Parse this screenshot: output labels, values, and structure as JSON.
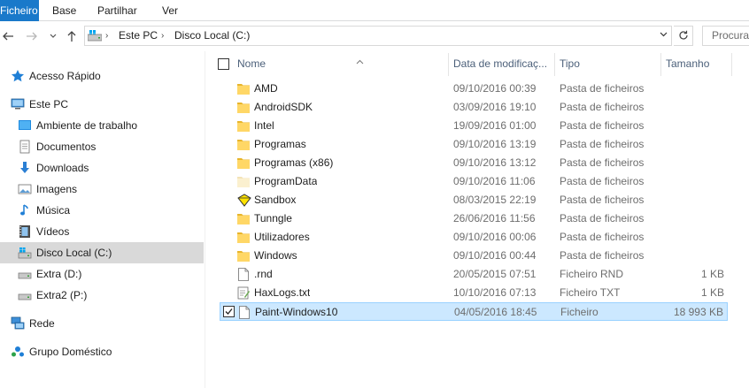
{
  "ribbon": {
    "tabs": [
      "Ficheiro",
      "Base",
      "Partilhar",
      "Ver"
    ]
  },
  "address": {
    "crumbs": [
      "Este PC",
      "Disco Local (C:)"
    ],
    "search_placeholder": "Procurar"
  },
  "sidebar": {
    "items": [
      {
        "label": "Acesso Rápido",
        "icon": "star-icon"
      },
      {
        "label": "Este PC",
        "icon": "computer-icon"
      },
      {
        "label": "Ambiente de trabalho",
        "icon": "desktop-icon"
      },
      {
        "label": "Documentos",
        "icon": "documents-icon"
      },
      {
        "label": "Downloads",
        "icon": "download-icon"
      },
      {
        "label": "Imagens",
        "icon": "pictures-icon"
      },
      {
        "label": "Música",
        "icon": "music-icon"
      },
      {
        "label": "Vídeos",
        "icon": "videos-icon"
      },
      {
        "label": "Disco Local (C:)",
        "icon": "drive-c-icon"
      },
      {
        "label": "Extra (D:)",
        "icon": "drive-icon"
      },
      {
        "label": "Extra2 (P:)",
        "icon": "drive-icon"
      },
      {
        "label": "Rede",
        "icon": "network-icon"
      },
      {
        "label": "Grupo Doméstico",
        "icon": "homegroup-icon"
      }
    ]
  },
  "columns": {
    "name": "Nome",
    "date": "Data de modificaç...",
    "type": "Tipo",
    "size": "Tamanho"
  },
  "files": [
    {
      "name": "AMD",
      "date": "09/10/2016 00:39",
      "type": "Pasta de ficheiros",
      "size": "",
      "icon": "folder-icon"
    },
    {
      "name": "AndroidSDK",
      "date": "03/09/2016 19:10",
      "type": "Pasta de ficheiros",
      "size": "",
      "icon": "folder-icon"
    },
    {
      "name": "Intel",
      "date": "19/09/2016 01:00",
      "type": "Pasta de ficheiros",
      "size": "",
      "icon": "folder-icon"
    },
    {
      "name": "Programas",
      "date": "09/10/2016 13:19",
      "type": "Pasta de ficheiros",
      "size": "",
      "icon": "folder-icon"
    },
    {
      "name": "Programas (x86)",
      "date": "09/10/2016 13:12",
      "type": "Pasta de ficheiros",
      "size": "",
      "icon": "folder-icon"
    },
    {
      "name": "ProgramData",
      "date": "09/10/2016 11:06",
      "type": "Pasta de ficheiros",
      "size": "",
      "icon": "hidden-folder-icon"
    },
    {
      "name": "Sandbox",
      "date": "08/03/2015 22:19",
      "type": "Pasta de ficheiros",
      "size": "",
      "icon": "sandbox-icon"
    },
    {
      "name": "Tunngle",
      "date": "26/06/2016 11:56",
      "type": "Pasta de ficheiros",
      "size": "",
      "icon": "folder-icon"
    },
    {
      "name": "Utilizadores",
      "date": "09/10/2016 00:06",
      "type": "Pasta de ficheiros",
      "size": "",
      "icon": "folder-icon"
    },
    {
      "name": "Windows",
      "date": "09/10/2016 00:44",
      "type": "Pasta de ficheiros",
      "size": "",
      "icon": "folder-icon"
    },
    {
      "name": ".rnd",
      "date": "20/05/2015 07:51",
      "type": "Ficheiro RND",
      "size": "1 KB",
      "icon": "file-icon"
    },
    {
      "name": "HaxLogs.txt",
      "date": "10/10/2016 07:13",
      "type": "Ficheiro TXT",
      "size": "1 KB",
      "icon": "text-file-icon"
    },
    {
      "name": "Paint-Windows10",
      "date": "04/05/2016 18:45",
      "type": "Ficheiro",
      "size": "18 993 KB",
      "icon": "file-icon"
    }
  ],
  "colors": {
    "file_tab": "#1979ca",
    "selection": "#cce8ff",
    "selection_border": "#99d1ff",
    "folder": "#ffd766",
    "folder_dark": "#e8b52c"
  }
}
